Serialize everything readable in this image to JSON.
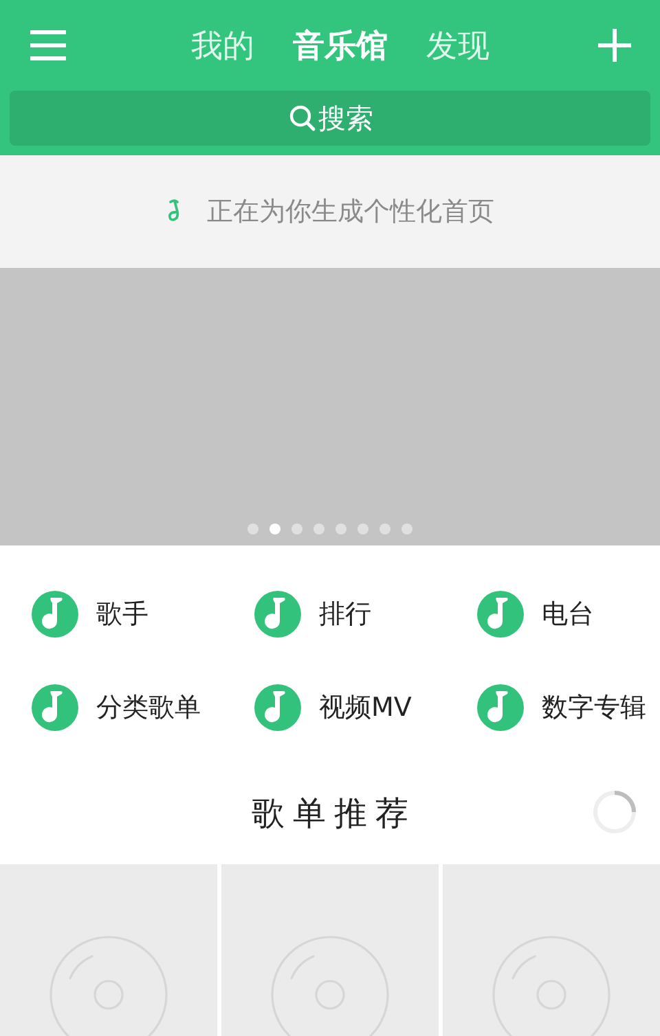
{
  "header": {
    "tabs": [
      {
        "label": "我的",
        "selected": false
      },
      {
        "label": "音乐馆",
        "selected": true
      },
      {
        "label": "发现",
        "selected": false
      }
    ],
    "search": {
      "placeholder": "搜索"
    }
  },
  "notice": {
    "text": "正在为你生成个性化首页"
  },
  "banner": {
    "dots": [
      {
        "selected": false
      },
      {
        "selected": true
      },
      {
        "selected": false
      },
      {
        "selected": false
      },
      {
        "selected": false
      },
      {
        "selected": false
      },
      {
        "selected": false
      },
      {
        "selected": false
      }
    ]
  },
  "categories": [
    {
      "label": "歌手"
    },
    {
      "label": "排行"
    },
    {
      "label": "电台"
    },
    {
      "label": "分类歌单"
    },
    {
      "label": "视频MV"
    },
    {
      "label": "数字专辑"
    }
  ],
  "section": {
    "title": "歌单推荐",
    "loading": true
  },
  "playlist_cards": [
    {
      "kind": "placeholder"
    },
    {
      "kind": "placeholder"
    },
    {
      "kind": "placeholder"
    }
  ]
}
